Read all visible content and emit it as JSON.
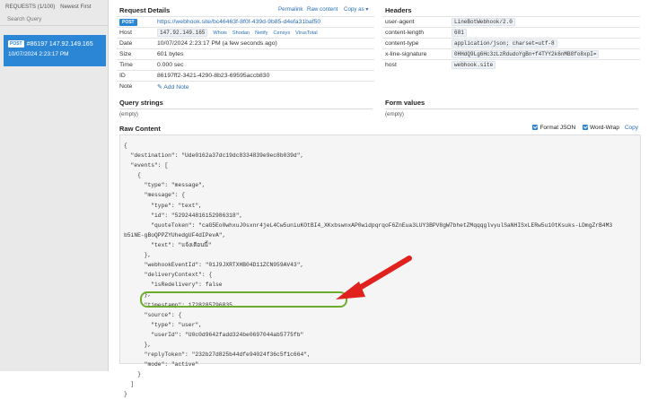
{
  "sidebar": {
    "requests_label": "REQUESTS (1/100)",
    "sort_label": "Newest First",
    "search_label": "Search Query",
    "item": {
      "method": "POST",
      "id_ip": "#86197 147.92.149.165",
      "time": "10/07/2024 2:23:17 PM"
    }
  },
  "details": {
    "title": "Request Details",
    "permalink": "Permalink",
    "raw_content_link": "Raw content",
    "copy_as": "Copy as ▾",
    "method": "POST",
    "url": "https://webhook.site/bc46463f-8f0f-439d-9b85-d4efa31baf50",
    "rows": [
      {
        "key": "Host",
        "value": "147.92.149.165"
      },
      {
        "key": "Date",
        "value": "10/07/2024 2:23:17 PM (a few seconds ago)"
      },
      {
        "key": "Size",
        "value": "601 bytes"
      },
      {
        "key": "Time",
        "value": "0.000 sec"
      },
      {
        "key": "ID",
        "value": "86197ff2-3421-4290-8b23-69595accb830"
      },
      {
        "key": "Note",
        "value": ""
      }
    ],
    "host_links": [
      "Whois",
      "Shodan",
      "Netify",
      "Censys",
      "VirusTotal"
    ],
    "add_note": "Add Note"
  },
  "headers": {
    "title": "Headers",
    "rows": [
      {
        "key": "user-agent",
        "value": "LineBotWebhook/2.0"
      },
      {
        "key": "content-length",
        "value": "601"
      },
      {
        "key": "content-type",
        "value": "application/json; charset=utf-8"
      },
      {
        "key": "x-line-signature",
        "value": "0HHdQ9Lg6Hc3zLzRdudoYgBn+f4TYY2k6nMB8fo8xpI="
      },
      {
        "key": "host",
        "value": "webhook.site"
      }
    ]
  },
  "query": {
    "title": "Query strings",
    "empty": "(empty)"
  },
  "form": {
    "title": "Form values",
    "empty": "(empty)"
  },
  "raw": {
    "title": "Raw Content",
    "format_json": "Format JSON",
    "word_wrap": "Word-Wrap",
    "copy": "Copy",
    "body": "{\n  \"destination\": \"Ude0162a37dc19dc8334839e9ec8b039d\",\n  \"events\": [\n    {\n      \"type\": \"message\",\n      \"message\": {\n        \"type\": \"text\",\n        \"id\": \"529244816152986318\",\n        \"quoteToken\": \"caG5Eo0whxuJ0sxnr4jeL4Cw5uniuKOtBI4_XKxbswnxAP0widpqrqoF6ZnEua3LUY3BPV8gW7bhetZMqqqglvyulSaNHISxLERw5u10tKsuks-LDmgZrB4M3\nb5iNE-gBoQPPZYUhedgUF4dIPevA\",\n        \"text\": \"แจ้งเตือนนี้\"\n      },\n      \"webhookEventId\": \"01J9JXRTXHB04D11ZCN959AV43\",\n      \"deliveryContext\": {\n        \"isRedelivery\": false\n      },\n      \"timestamp\": 1728285796835,\n      \"source\": {\n        \"type\": \"user\",\n        \"userId\": \"U0c0d9642fadd324be0697044ab5775fb\"\n      },\n      \"replyToken\": \"232b27d825b44dfe94024f36c5f1c664\",\n      \"mode\": \"active\"\n    }\n  ]\n}"
  },
  "colors": {
    "accent": "#2c86d6",
    "highlight_ring": "#6cae2c",
    "arrow": "#e0211d"
  }
}
